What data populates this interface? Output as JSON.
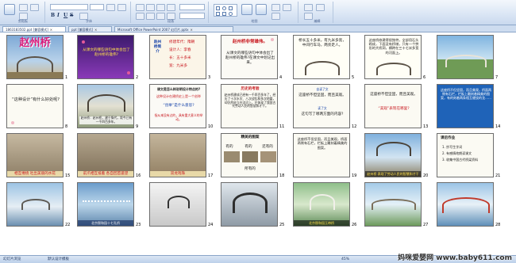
{
  "ribbon": {
    "clipboard_label": "剪贴板",
    "font_label": "字体",
    "paragraph_label": "段落",
    "drawing_label": "绘图",
    "editing_label": "编辑",
    "bold": "B",
    "italic": "I",
    "underline": "U",
    "strike": "S"
  },
  "tabs": [
    {
      "label": "1863183502.ppt [兼容模式]",
      "active": true
    },
    {
      "label": "ppt [兼容模式]",
      "active": false
    },
    {
      "label": "Microsoft Office PowerPoint 2007 幻灯片.pptx",
      "active": false
    }
  ],
  "slides": {
    "s1": {
      "num": "1",
      "title": "赵州桥"
    },
    "s2": {
      "num": "2",
      "text": "从课文的哪些语句中体会出了赵州桥的雄伟?"
    },
    "s3": {
      "num": "3",
      "left": "赵州桥简介",
      "lines": [
        "修建年代：隋朝",
        "设计人：李春",
        "长：五十多米",
        "宽：九米多"
      ]
    },
    "s4": {
      "num": "4",
      "title": "赵州桥非常雄伟。",
      "text": "从课文的哪些语句中体会出了赵州桥的雄伟?在课文中划记出来。"
    },
    "s5": {
      "num": "5",
      "text": "桥长五十多米，有九米多宽，中间行车马，两旁走人。"
    },
    "s6": {
      "num": "6",
      "text": "这座桥修建得很独特，全部用石头砌成，下面没有桥墩，只有一个拱形的大桥洞，横跨在三十七米多宽的河面上。"
    },
    "s7": {
      "num": "7"
    },
    "s8": {
      "num": "8",
      "text": "“这种设计”有什么好处呢?"
    },
    "s9": {
      "num": "9",
      "caption": "赵州桥：赵州桥，建于隋代，距今已有一千四百多年。"
    },
    "s10": {
      "num": "10",
      "title": "课文是怎么样说明设计特点的?",
      "q1": "这种设计在建桥史上是一个创举",
      "q2": "“创举”是什么意思?",
      "ans": "指从来没有过的，具有重大意义的举动。"
    },
    "s11": {
      "num": "11",
      "title": "历史的考验",
      "text": "赵州桥建成已经有一千四百多年了，经历了十次水灾、八次战乱和多次地震，却仍然屹立在洨河上，它体现了我国古代劳动人民的智慧和才干。"
    },
    "s12": {
      "num": "12",
      "head1": "自读了文",
      "line1": "这座桥不但坚固，而且美观。",
      "head2": "读了文",
      "line2": "这句写了哪两方面的内容?"
    },
    "s13": {
      "num": "13",
      "line1": "这座桥不但坚固，而且美观。",
      "line2": "“美观”表现在哪里?"
    },
    "s14": {
      "num": "14",
      "text": "这座桥不但坚固，而且美观，桥面两侧有石栏，栏板上雕刻着精美的图案，有的刻着两条相互缠绕的龙……"
    },
    "s15": {
      "num": "15",
      "caption": "相互缠绕 吐出美丽的水花"
    },
    "s16": {
      "num": "16",
      "caption": "前爪相互抵着 各自回首遥望"
    },
    "s17": {
      "num": "17",
      "caption": "双龙戏珠"
    },
    "s18": {
      "num": "18",
      "title": "精美的图案",
      "labels": [
        "有的",
        "有的",
        "还有的",
        "所有的"
      ]
    },
    "s19": {
      "num": "19",
      "text": "这座桥不但坚固，而且美观，桥面两侧有石栏，栏板上雕刻着精美的图案。"
    },
    "s20": {
      "num": "20",
      "caption": "赵州桥 表现了劳动人民的智慧和才干"
    },
    "s21": {
      "num": "21",
      "title": "课后作业",
      "items": [
        "1. 抄写生字词",
        "2. 有感情地朗读课文",
        "3. 收集中国古代桥梁资料"
      ]
    },
    "s22": {
      "num": "22"
    },
    "s23": {
      "num": "23",
      "caption": "北京颐和园十七孔桥"
    },
    "s24": {
      "num": "24"
    },
    "s25": {
      "num": "25"
    },
    "s26": {
      "num": "26",
      "caption": "北京颐和园玉带桥"
    },
    "s27": {
      "num": "27"
    },
    "s28": {
      "num": "28"
    }
  },
  "status": {
    "view": "幻灯片浏览",
    "theme": "默认设计模板",
    "zoom": "45%"
  },
  "watermark": "妈咪爱婴网 www.baby611.com",
  "colors": {
    "ribbon": "#dce7f5",
    "accent_red": "#c8161d",
    "accent_blue": "#1340a8"
  }
}
